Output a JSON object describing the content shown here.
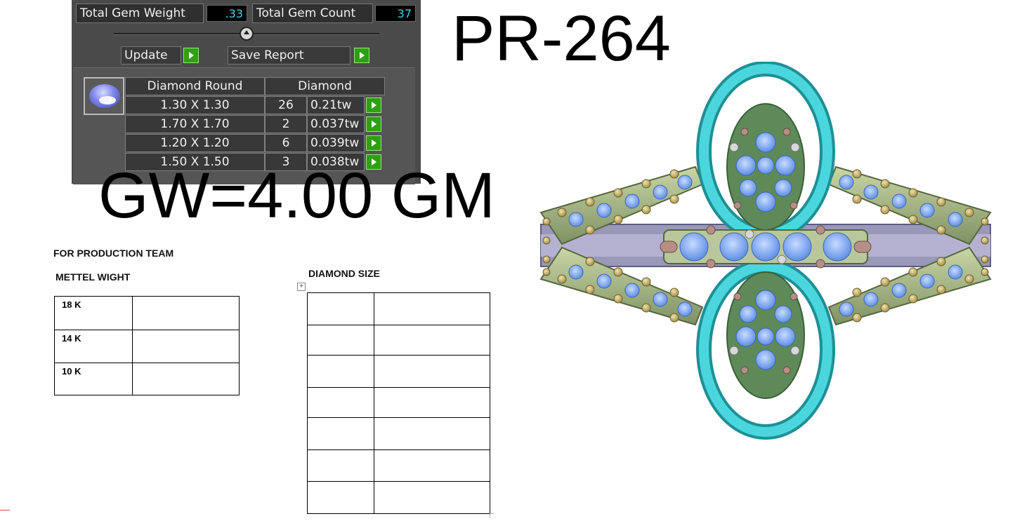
{
  "gem_report": {
    "total_weight_label": "Total Gem Weight",
    "total_weight_value": ".33",
    "total_count_label": "Total Gem Count",
    "total_count_value": "37",
    "update_label": "Update",
    "save_report_label": "Save Report",
    "col_shape": "Diamond Round",
    "col_type": "Diamond",
    "rows": [
      {
        "size": "1.30 X 1.30",
        "count": "26",
        "weight": "0.21tw"
      },
      {
        "size": "1.70 X 1.70",
        "count": "2",
        "weight": "0.037tw"
      },
      {
        "size": "1.20 X 1.20",
        "count": "6",
        "weight": "0.039tw"
      },
      {
        "size": "1.50 X 1.50",
        "count": "3",
        "weight": "0.038tw"
      }
    ]
  },
  "product_code": "PR-264",
  "gross_weight": "GW=4.00 GM",
  "production": {
    "heading": "FOR PRODUCTION TEAM",
    "metal_heading": "METTEL WIGHT",
    "metal_rows": [
      "18 K",
      "14 K",
      "10 K"
    ],
    "diamond_heading": "DIAMOND SIZE",
    "move_icon": "move-handle-icon"
  },
  "colors": {
    "panel_bg": "#4a4a4a",
    "value_text": "#3fd6e8",
    "go_button": "#2ea012",
    "ring_teal": "#35c4c9",
    "ring_band": "#9fb07a",
    "gem_blue": "#7fa8f0"
  }
}
